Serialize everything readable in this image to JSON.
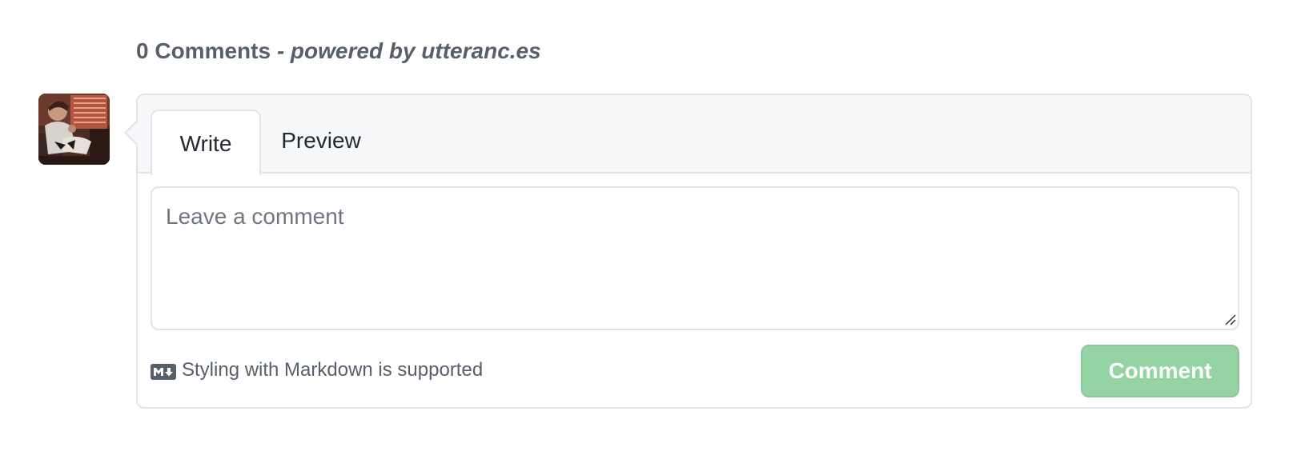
{
  "header": {
    "count_label": "0 Comments",
    "powered_by": "- powered by utteranc.es"
  },
  "tabs": [
    {
      "label": "Write",
      "selected": true
    },
    {
      "label": "Preview",
      "selected": false
    }
  ],
  "comment_box": {
    "placeholder": "Leave a comment",
    "value": ""
  },
  "footer": {
    "markdown_hint": "Styling with Markdown is supported",
    "markdown_icon": "markdown-icon",
    "submit_label": "Comment",
    "submit_disabled": true
  },
  "colors": {
    "button_bg": "#94d3a2",
    "border": "#e1e4e8",
    "tabs_bg": "#f6f8fa",
    "muted_text": "#57606a"
  }
}
